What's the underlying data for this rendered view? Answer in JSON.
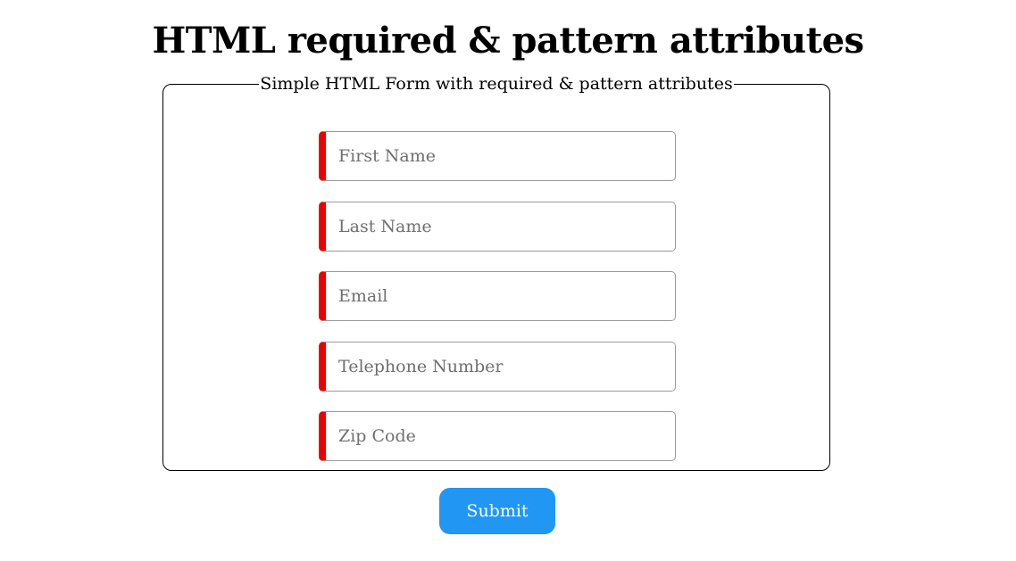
{
  "page": {
    "title": "HTML required & pattern attributes"
  },
  "form": {
    "legend": "Simple HTML Form with required & pattern attributes",
    "fields": [
      {
        "placeholder": "First Name",
        "value": ""
      },
      {
        "placeholder": "Last Name",
        "value": ""
      },
      {
        "placeholder": "Email",
        "value": ""
      },
      {
        "placeholder": "Telephone Number",
        "value": ""
      },
      {
        "placeholder": "Zip Code",
        "value": ""
      }
    ],
    "submit_label": "Submit"
  },
  "colors": {
    "required_marker": "#ee0000",
    "submit_background": "#2196f3",
    "submit_text": "#ffffff"
  }
}
